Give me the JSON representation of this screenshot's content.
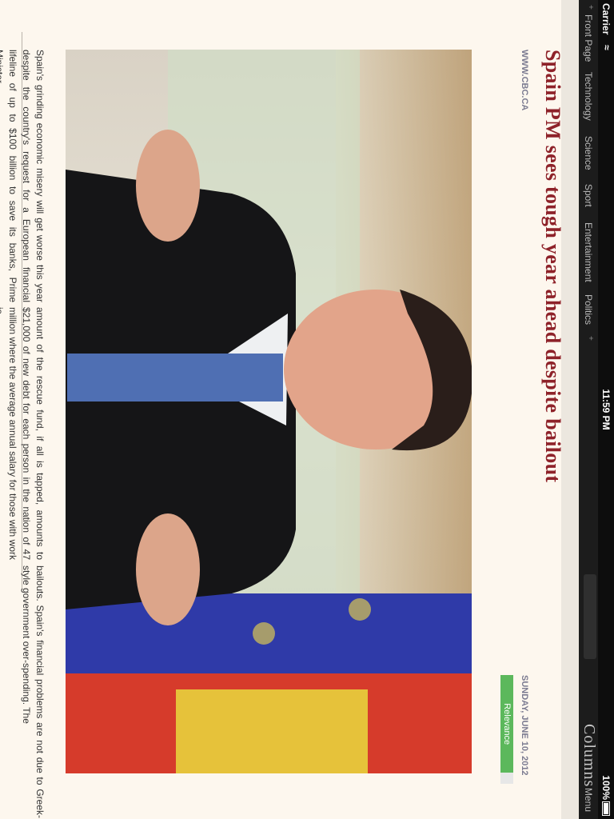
{
  "status": {
    "carrier": "Carrier",
    "time": "11:59 PM",
    "battery": "100%"
  },
  "nav": {
    "items": [
      "Front Page",
      "Technology",
      "Science",
      "Sport",
      "Entertainment",
      "Politics"
    ],
    "brand": "Columns",
    "menu_label": "Menu"
  },
  "article": {
    "title": "Spain PM sees tough year ahead despite bailout",
    "source": "WWW.CBC.CA",
    "date": "SUNDAY, JUNE 10, 2012",
    "relevance_label": "Relevance",
    "relevance_fraction": 0.9,
    "photo_description": "Spain PM speaking at a podium with EU and Spanish flags",
    "col1": "Spain's grinding economic misery will get worse this year despite the country's request for a European financial lifeline of up to $100 billion to save its banks, Prime Minister",
    "col2": "amount of the rescue fund, if all is tapped, amounts to $21,000 of new debt for each person in the nation of 47 million where the average annual salary for those with work is",
    "col3": "bailouts. Spain's financial problems are not due to Greek-style government over-spending. The"
  }
}
